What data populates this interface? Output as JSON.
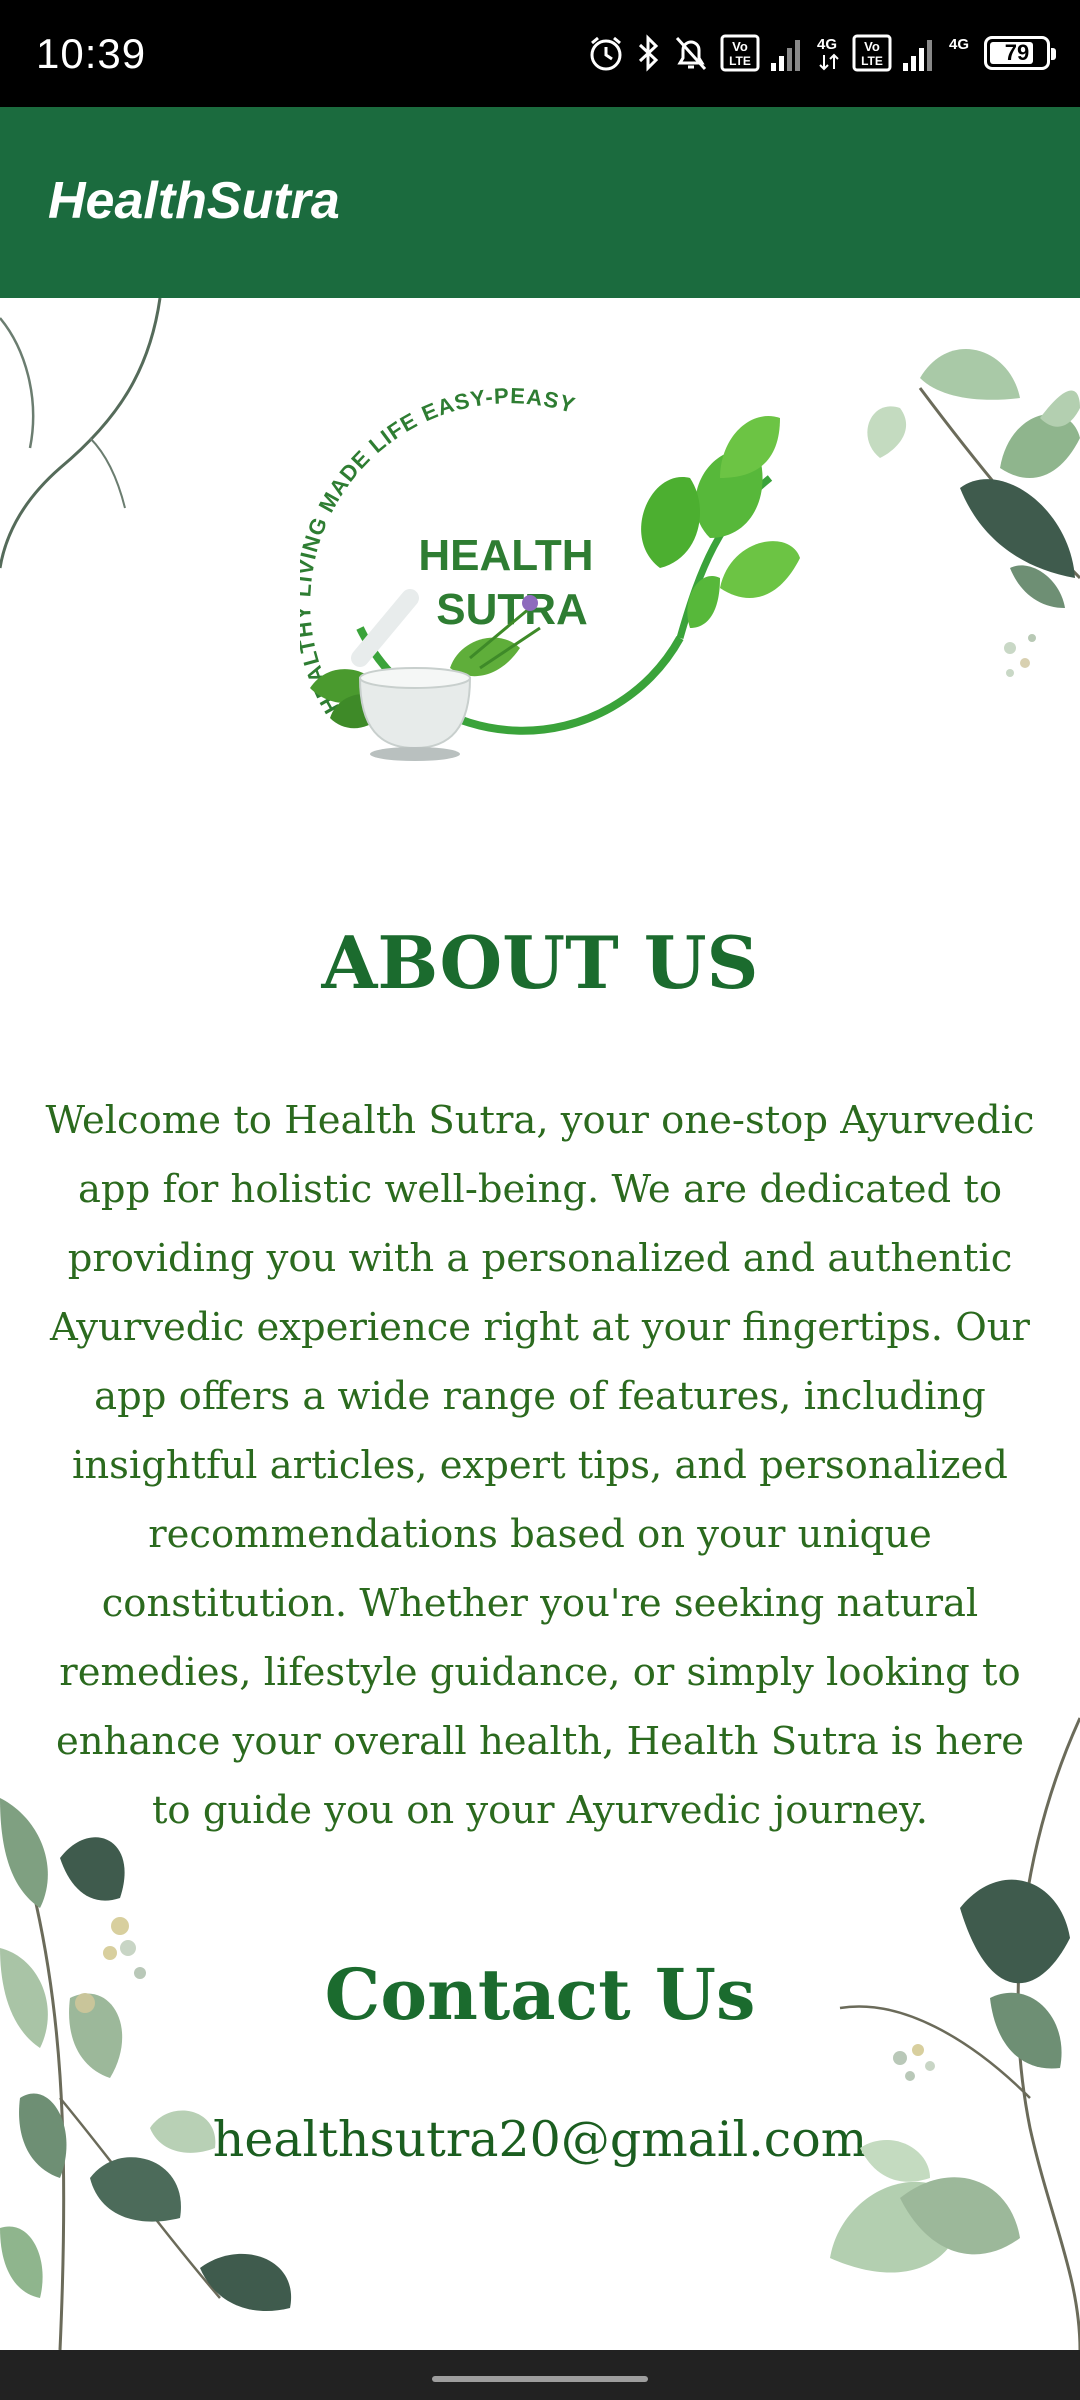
{
  "status_bar": {
    "time": "10:39",
    "battery": "79",
    "battery_level": 0.79,
    "network_1": "4G",
    "network_2": "4G",
    "volte_1": "Vo LTE",
    "volte_2": "Vo LTE"
  },
  "app_bar": {
    "title": "HealthSutra",
    "color": "#1b6b3e"
  },
  "logo": {
    "tagline": "HEALTHY LIVING MADE LIFE EASY-PEASY",
    "line1": "HEALTH",
    "line2": "SUTRA"
  },
  "about": {
    "heading": "ABOUT US",
    "body": "Welcome to Health Sutra, your one-stop Ayurvedic app for holistic well-being. We are dedicated to providing you with a personalized and authentic Ayurvedic experience right at your fingertips. Our app offers a wide range of features, including insightful articles, expert tips, and personalized recommendations based on your unique constitution. Whether you're seeking natural remedies, lifestyle guidance, or simply looking to enhance your overall health, Health Sutra is here to guide you on your Ayurvedic journey."
  },
  "contact": {
    "heading": "Contact Us",
    "email": "healthsutra20@gmail.com"
  },
  "colors": {
    "accent": "#1b6b2e",
    "text": "#2b6a1e"
  }
}
